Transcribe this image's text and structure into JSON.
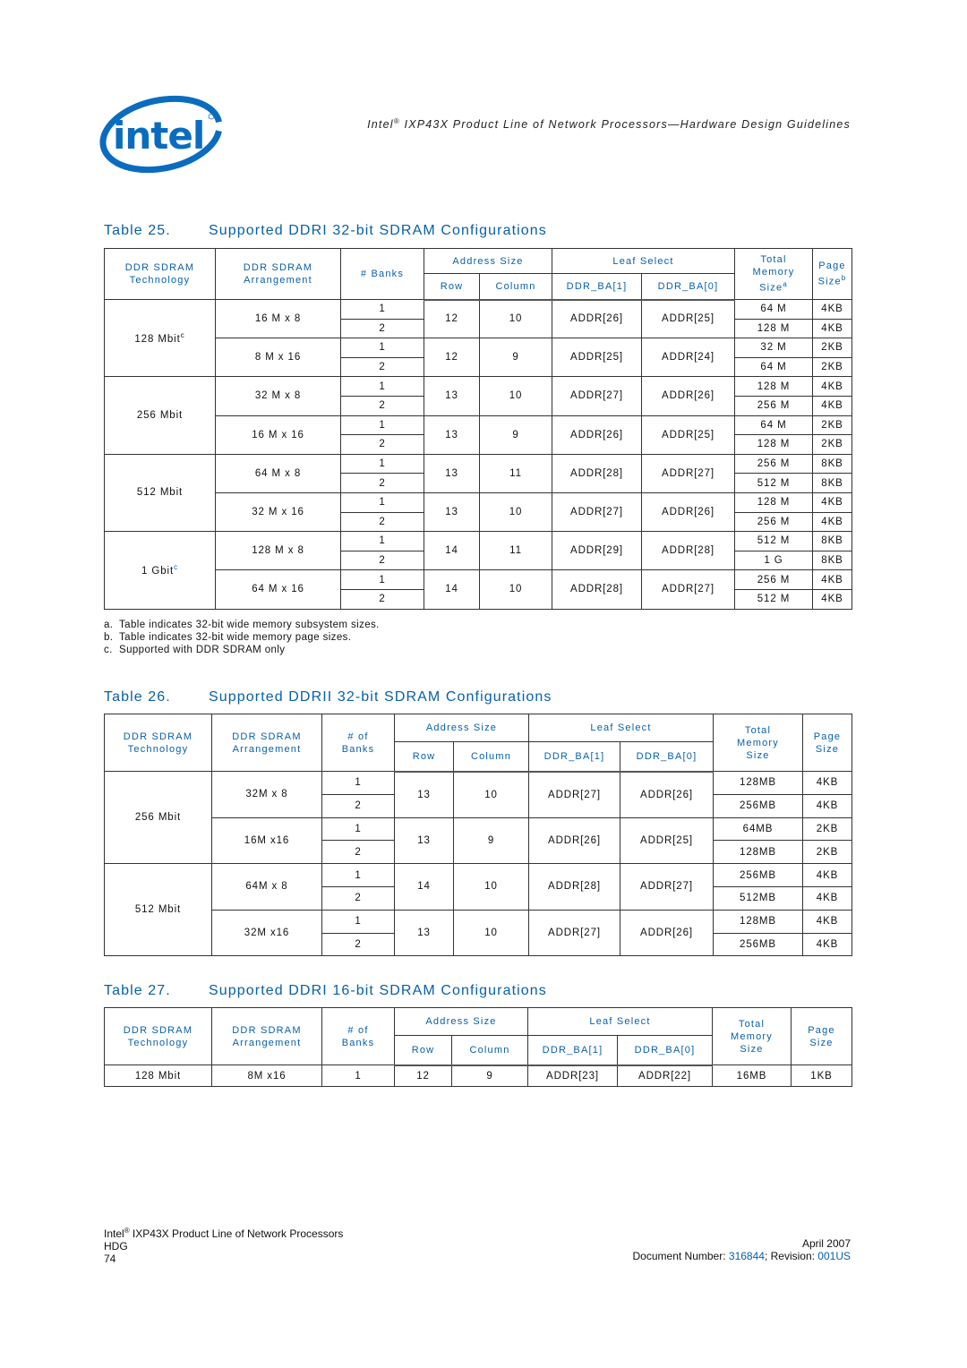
{
  "header": {
    "logo_text": "intel",
    "running_title_prefix": "Intel",
    "running_title_reg": "®",
    "running_title_rest": " IXP43X Product Line of Network Processors—Hardware Design Guidelines"
  },
  "table25": {
    "number": "Table 25.",
    "title": "Supported DDRI 32-bit SDRAM Configurations",
    "headers": {
      "technology_1": "DDR SDRAM",
      "technology_2": "Technology",
      "arrangement_1": "DDR SDRAM",
      "arrangement_2": "Arrangement",
      "banks": "# Banks",
      "address_size": "Address Size",
      "row": "Row",
      "column": "Column",
      "leaf_select": "Leaf Select",
      "ba1": "DDR_BA[1]",
      "ba0": "DDR_BA[0]",
      "total_1": "Total",
      "total_2": "Memory",
      "total_3": "Size",
      "total_sup": "a",
      "page_1": "Page",
      "page_2": "Size",
      "page_sup": "b"
    },
    "groups": [
      {
        "technology": "128 Mbit",
        "tech_sup": "c",
        "arrangements": [
          {
            "arrangement": "16 M x 8",
            "row": "12",
            "column": "10",
            "ba1": "ADDR[26]",
            "ba0": "ADDR[25]",
            "rows": [
              {
                "banks": "1",
                "total": "64 M",
                "page": "4KB"
              },
              {
                "banks": "2",
                "total": "128 M",
                "page": "4KB"
              }
            ]
          },
          {
            "arrangement": "8 M x 16",
            "row": "12",
            "column": "9",
            "ba1": "ADDR[25]",
            "ba0": "ADDR[24]",
            "rows": [
              {
                "banks": "1",
                "total": "32 M",
                "page": "2KB"
              },
              {
                "banks": "2",
                "total": "64 M",
                "page": "2KB"
              }
            ]
          }
        ]
      },
      {
        "technology": "256 Mbit",
        "tech_sup": "",
        "arrangements": [
          {
            "arrangement": "32 M x 8",
            "row": "13",
            "column": "10",
            "ba1": "ADDR[27]",
            "ba0": "ADDR[26]",
            "rows": [
              {
                "banks": "1",
                "total": "128 M",
                "page": "4KB"
              },
              {
                "banks": "2",
                "total": "256 M",
                "page": "4KB"
              }
            ]
          },
          {
            "arrangement": "16 M x 16",
            "row": "13",
            "column": "9",
            "ba1": "ADDR[26]",
            "ba0": "ADDR[25]",
            "rows": [
              {
                "banks": "1",
                "total": "64 M",
                "page": "2KB"
              },
              {
                "banks": "2",
                "total": "128 M",
                "page": "2KB"
              }
            ]
          }
        ]
      },
      {
        "technology": "512 Mbit",
        "tech_sup": "",
        "arrangements": [
          {
            "arrangement": "64 M x 8",
            "row": "13",
            "column": "11",
            "ba1": "ADDR[28]",
            "ba0": "ADDR[27]",
            "rows": [
              {
                "banks": "1",
                "total": "256 M",
                "page": "8KB"
              },
              {
                "banks": "2",
                "total": "512 M",
                "page": "8KB"
              }
            ]
          },
          {
            "arrangement": "32 M x 16",
            "row": "13",
            "column": "10",
            "ba1": "ADDR[27]",
            "ba0": "ADDR[26]",
            "rows": [
              {
                "banks": "1",
                "total": "128 M",
                "page": "4KB"
              },
              {
                "banks": "2",
                "total": "256 M",
                "page": "4KB"
              }
            ]
          }
        ]
      },
      {
        "technology": "1 Gbit",
        "tech_sup": "c",
        "arrangements": [
          {
            "arrangement": "128 M x 8",
            "row": "14",
            "column": "11",
            "ba1": "ADDR[29]",
            "ba0": "ADDR[28]",
            "rows": [
              {
                "banks": "1",
                "total": "512 M",
                "page": "8KB"
              },
              {
                "banks": "2",
                "total": "1 G",
                "page": "8KB"
              }
            ]
          },
          {
            "arrangement": "64 M x 16",
            "row": "14",
            "column": "10",
            "ba1": "ADDR[28]",
            "ba0": "ADDR[27]",
            "rows": [
              {
                "banks": "1",
                "total": "256 M",
                "page": "4KB"
              },
              {
                "banks": "2",
                "total": "512 M",
                "page": "4KB"
              }
            ]
          }
        ]
      }
    ],
    "footnotes": [
      {
        "label": "a.",
        "text": "Table indicates 32-bit wide memory subsystem sizes."
      },
      {
        "label": "b.",
        "text": "Table indicates 32-bit wide memory page sizes."
      },
      {
        "label": "c.",
        "text": "Supported with DDR SDRAM only"
      }
    ]
  },
  "table26": {
    "number": "Table 26.",
    "title": "Supported DDRII 32-bit SDRAM Configurations",
    "headers": {
      "technology_1": "DDR SDRAM",
      "technology_2": "Technology",
      "arrangement_1": "DDR SDRAM",
      "arrangement_2": "Arrangement",
      "banks_1": "# of",
      "banks_2": "Banks",
      "address_size": "Address Size",
      "row": "Row",
      "column": "Column",
      "leaf_select": "Leaf Select",
      "ba1": "DDR_BA[1]",
      "ba0": "DDR_BA[0]",
      "total_1": "Total",
      "total_2": "Memory",
      "total_3": "Size",
      "page_1": "Page",
      "page_2": "Size"
    },
    "groups": [
      {
        "technology": "256 Mbit",
        "arrangements": [
          {
            "arrangement": "32M x 8",
            "row": "13",
            "column": "10",
            "ba1": "ADDR[27]",
            "ba0": "ADDR[26]",
            "rows": [
              {
                "banks": "1",
                "total": "128MB",
                "page": "4KB"
              },
              {
                "banks": "2",
                "total": "256MB",
                "page": "4KB"
              }
            ]
          },
          {
            "arrangement": "16M x16",
            "row": "13",
            "column": "9",
            "ba1": "ADDR[26]",
            "ba0": "ADDR[25]",
            "rows": [
              {
                "banks": "1",
                "total": "64MB",
                "page": "2KB"
              },
              {
                "banks": "2",
                "total": "128MB",
                "page": "2KB"
              }
            ]
          }
        ]
      },
      {
        "technology": "512 Mbit",
        "arrangements": [
          {
            "arrangement": "64M x 8",
            "row": "14",
            "column": "10",
            "ba1": "ADDR[28]",
            "ba0": "ADDR[27]",
            "rows": [
              {
                "banks": "1",
                "total": "256MB",
                "page": "4KB"
              },
              {
                "banks": "2",
                "total": "512MB",
                "page": "4KB"
              }
            ]
          },
          {
            "arrangement": "32M x16",
            "row": "13",
            "column": "10",
            "ba1": "ADDR[27]",
            "ba0": "ADDR[26]",
            "rows": [
              {
                "banks": "1",
                "total": "128MB",
                "page": "4KB"
              },
              {
                "banks": "2",
                "total": "256MB",
                "page": "4KB"
              }
            ]
          }
        ]
      }
    ]
  },
  "table27": {
    "number": "Table 27.",
    "title": "Supported DDRI 16-bit SDRAM Configurations",
    "headers": {
      "technology_1": "DDR SDRAM",
      "technology_2": "Technology",
      "arrangement_1": "DDR SDRAM",
      "arrangement_2": "Arrangement",
      "banks_1": "# of",
      "banks_2": "Banks",
      "address_size": "Address Size",
      "row": "Row",
      "column": "Column",
      "leaf_select": "Leaf Select",
      "ba1": "DDR_BA[1]",
      "ba0": "DDR_BA[0]",
      "total_1": "Total",
      "total_2": "Memory",
      "total_3": "Size",
      "page_1": "Page",
      "page_2": "Size"
    },
    "row": {
      "technology": "128 Mbit",
      "arrangement": "8M x16",
      "banks": "1",
      "row": "12",
      "column": "9",
      "ba1": "ADDR[23]",
      "ba0": "ADDR[22]",
      "total": "16MB",
      "page": "1KB"
    }
  },
  "footer": {
    "product_prefix": "Intel",
    "product_reg": "®",
    "product_rest": " IXP43X Product Line of Network Processors",
    "doc_type": "HDG",
    "page_number": "74",
    "date": "April 2007",
    "doc_number_label": "Document Number: ",
    "doc_number": "316844",
    "revision_label": "; Revision: ",
    "revision": "001US"
  }
}
